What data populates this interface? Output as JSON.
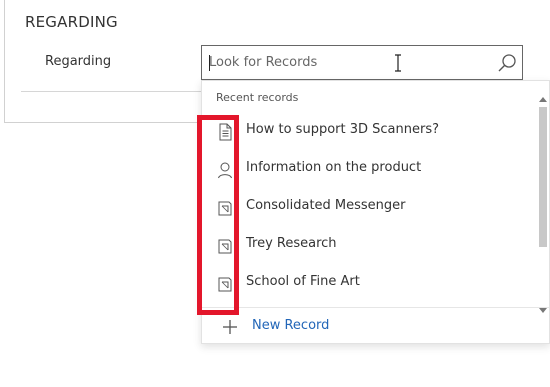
{
  "section": {
    "title": "REGARDING"
  },
  "field": {
    "label": "Regarding",
    "value": "",
    "placeholder": "Look for Records"
  },
  "dropdown": {
    "recent_label": "Recent records",
    "items": [
      {
        "label": "How to support 3D Scanners?",
        "icon": "document-icon"
      },
      {
        "label": "Information on the product",
        "icon": "contact-icon"
      },
      {
        "label": "Consolidated Messenger",
        "icon": "account-icon"
      },
      {
        "label": "Trey Research",
        "icon": "account-icon"
      },
      {
        "label": "School of Fine Art",
        "icon": "account-icon"
      }
    ],
    "new_record_label": "New Record"
  },
  "colors": {
    "highlight": "#e3162b",
    "link": "#2266b8"
  }
}
